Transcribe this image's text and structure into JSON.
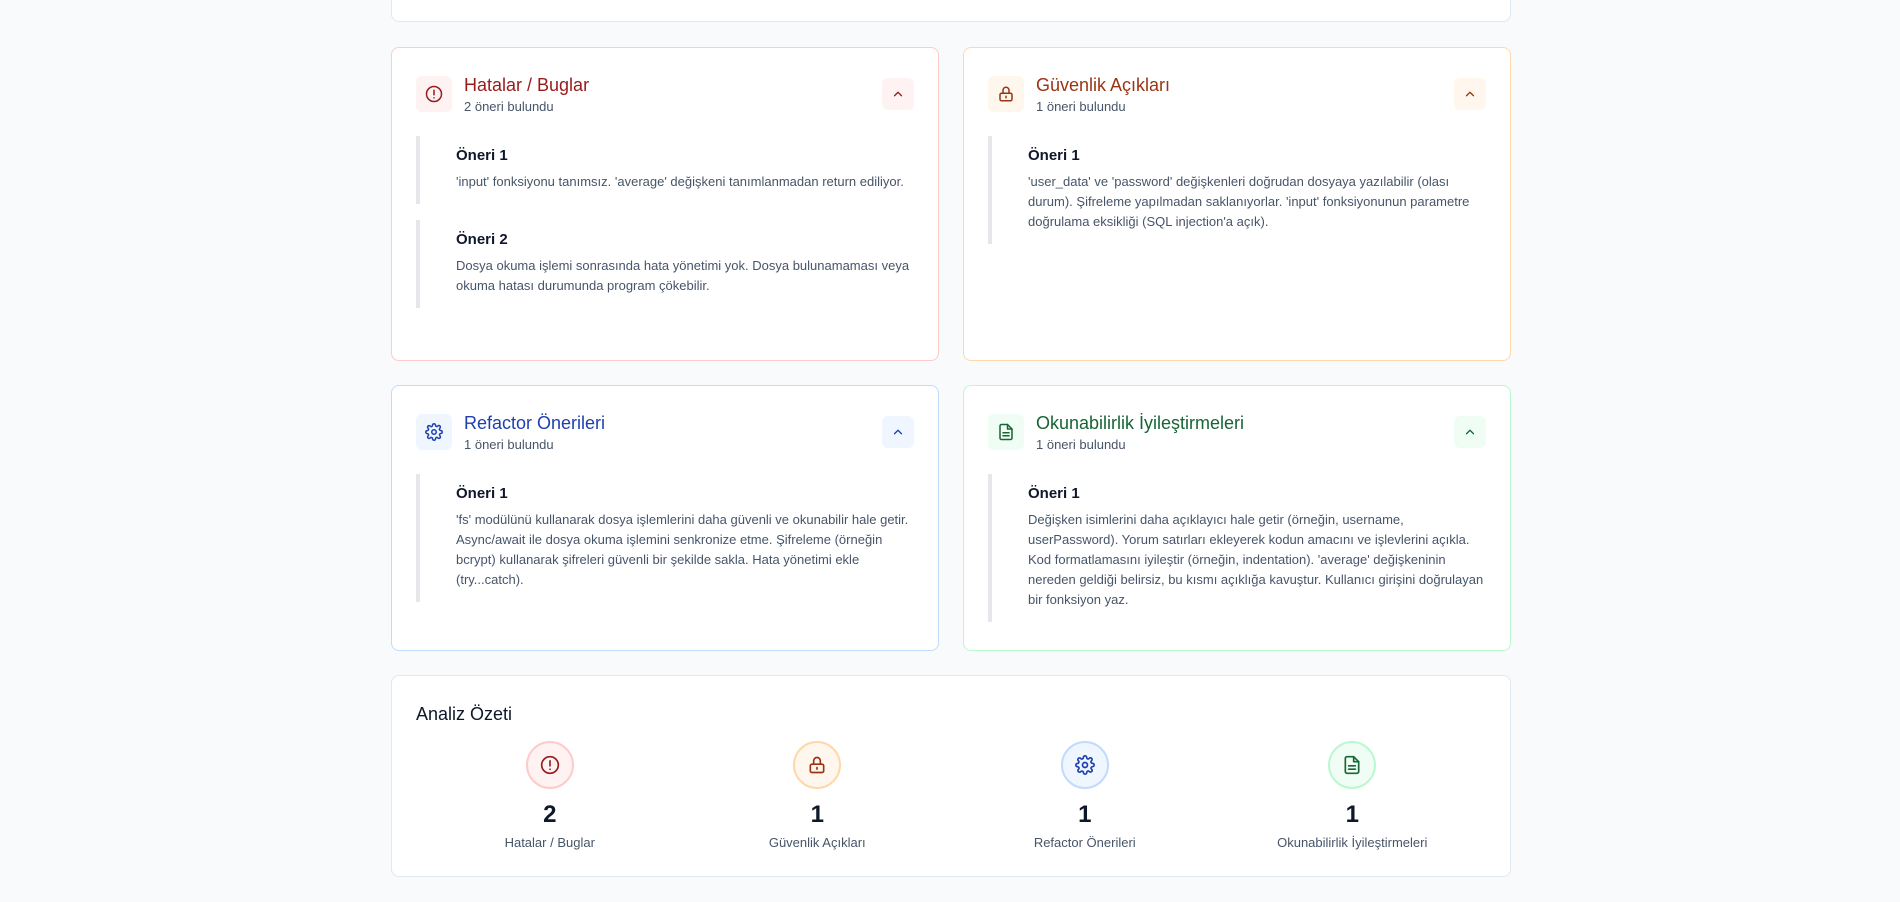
{
  "colors": {
    "bugs": "#991b1b",
    "security": "#9a3412",
    "refactor": "#1e40af",
    "readability": "#166534"
  },
  "cards": {
    "bugs": {
      "icon": "alert-circle-icon",
      "title": "Hatalar / Buglar",
      "count": "2 öneri bulundu",
      "suggestions": [
        {
          "title": "Öneri 1",
          "text": "'input' fonksiyonu tanımsız. 'average' değişkeni tanımlanmadan return ediliyor."
        },
        {
          "title": "Öneri 2",
          "text": "Dosya okuma işlemi sonrasında hata yönetimi yok. Dosya bulunamaması veya okuma hatası durumunda program çökebilir."
        }
      ]
    },
    "security": {
      "icon": "lock-icon",
      "title": "Güvenlik Açıkları",
      "count": "1 öneri bulundu",
      "suggestions": [
        {
          "title": "Öneri 1",
          "text": "'user_data' ve 'password' değişkenleri doğrudan dosyaya yazılabilir (olası durum). Şifreleme yapılmadan saklanıyorlar. 'input' fonksiyonunun parametre doğrulama eksikliği (SQL injection'a açık)."
        }
      ]
    },
    "refactor": {
      "icon": "gear-icon",
      "title": "Refactor Önerileri",
      "count": "1 öneri bulundu",
      "suggestions": [
        {
          "title": "Öneri 1",
          "text": "'fs' modülünü kullanarak dosya işlemlerini daha güvenli ve okunabilir hale getir. Async/await ile dosya okuma işlemini senkronize etme. Şifreleme (örneğin bcrypt) kullanarak şifreleri güvenli bir şekilde sakla. Hata yönetimi ekle (try...catch)."
        }
      ]
    },
    "readability": {
      "icon": "document-icon",
      "title": "Okunabilirlik İyileştirmeleri",
      "count": "1 öneri bulundu",
      "suggestions": [
        {
          "title": "Öneri 1",
          "text": "Değişken isimlerini daha açıklayıcı hale getir (örneğin, username, userPassword). Yorum satırları ekleyerek kodun amacını ve işlevlerini açıkla. Kod formatlamasını iyileştir (örneğin, indentation). 'average' değişkeninin nereden geldiği belirsiz, bu kısmı açıklığa kavuştur. Kullanıcı girişini doğrulayan bir fonksiyon yaz."
        }
      ]
    }
  },
  "summary": {
    "title": "Analiz Özeti",
    "stats": [
      {
        "value": "2",
        "label": "Hatalar / Buglar",
        "icon": "alert-circle-icon"
      },
      {
        "value": "1",
        "label": "Güvenlik Açıkları",
        "icon": "lock-icon"
      },
      {
        "value": "1",
        "label": "Refactor Önerileri",
        "icon": "gear-icon"
      },
      {
        "value": "1",
        "label": "Okunabilirlik İyileştirmeleri",
        "icon": "document-icon"
      }
    ]
  }
}
